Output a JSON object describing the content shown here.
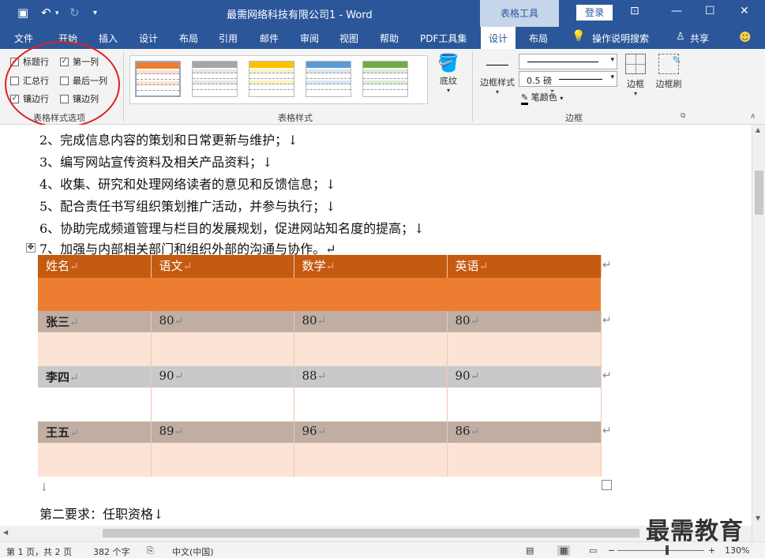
{
  "titlebar": {
    "doc_title": "最需网络科技有限公司1 - Word",
    "context_tab_group": "表格工具",
    "login": "登录"
  },
  "tabs": [
    "文件",
    "开始",
    "插入",
    "设计",
    "布局",
    "引用",
    "邮件",
    "审阅",
    "视图",
    "帮助",
    "PDF工具集",
    "设计",
    "布局"
  ],
  "active_tab_index": 11,
  "tell_me": "操作说明搜索",
  "share": "共享",
  "ribbon": {
    "style_options": {
      "label": "表格样式选项",
      "header_row": "标题行",
      "first_column": "第一列",
      "total_row": "汇总行",
      "last_column": "最后一列",
      "banded_rows": "镶边行",
      "banded_columns": "镶边列"
    },
    "table_styles_label": "表格样式",
    "shading_label": "底纹",
    "border_style_label": "边框样式",
    "pen_weight": "0.5 磅",
    "pen_color_label": "笔颜色",
    "borders_label": "边框",
    "border_painter_label": "边框刷",
    "borders_group_label": "边框"
  },
  "style_colors": {
    "orange": "#ed7d31",
    "gray": "#a5a5a5",
    "gold": "#ffc000",
    "blue": "#5b9bd5",
    "green": "#70ad47"
  },
  "doc": {
    "lines": [
      "2、完成信息内容的策划和日常更新与维护；↓",
      "3、编写网站宣传资料及相关产品资料；↓",
      "4、收集、研究和处理网络读者的意见和反馈信息；↓",
      "5、配合责任书写组织策划推广活动，并参与执行；↓",
      "6、协助完成频道管理与栏目的发展规划，促进网站知名度的提高；↓",
      "7、加强与内部相关部门和组织外部的沟通与协作。↵"
    ],
    "table": {
      "headers": [
        "姓名",
        "语文",
        "数学",
        "英语"
      ],
      "rows": [
        [
          "张三",
          "80",
          "80",
          "80"
        ],
        [
          "李四",
          "90",
          "88",
          "90"
        ],
        [
          "王五",
          "89",
          "96",
          "86"
        ]
      ]
    },
    "after_table_mark": "↓",
    "section2": "第二要求：任职资格↓"
  },
  "status": {
    "page": "第 1 页，共 2 页",
    "words": "382 个字",
    "lang": "中文(中国)",
    "zoom": "130%"
  },
  "watermark": "最需教育"
}
